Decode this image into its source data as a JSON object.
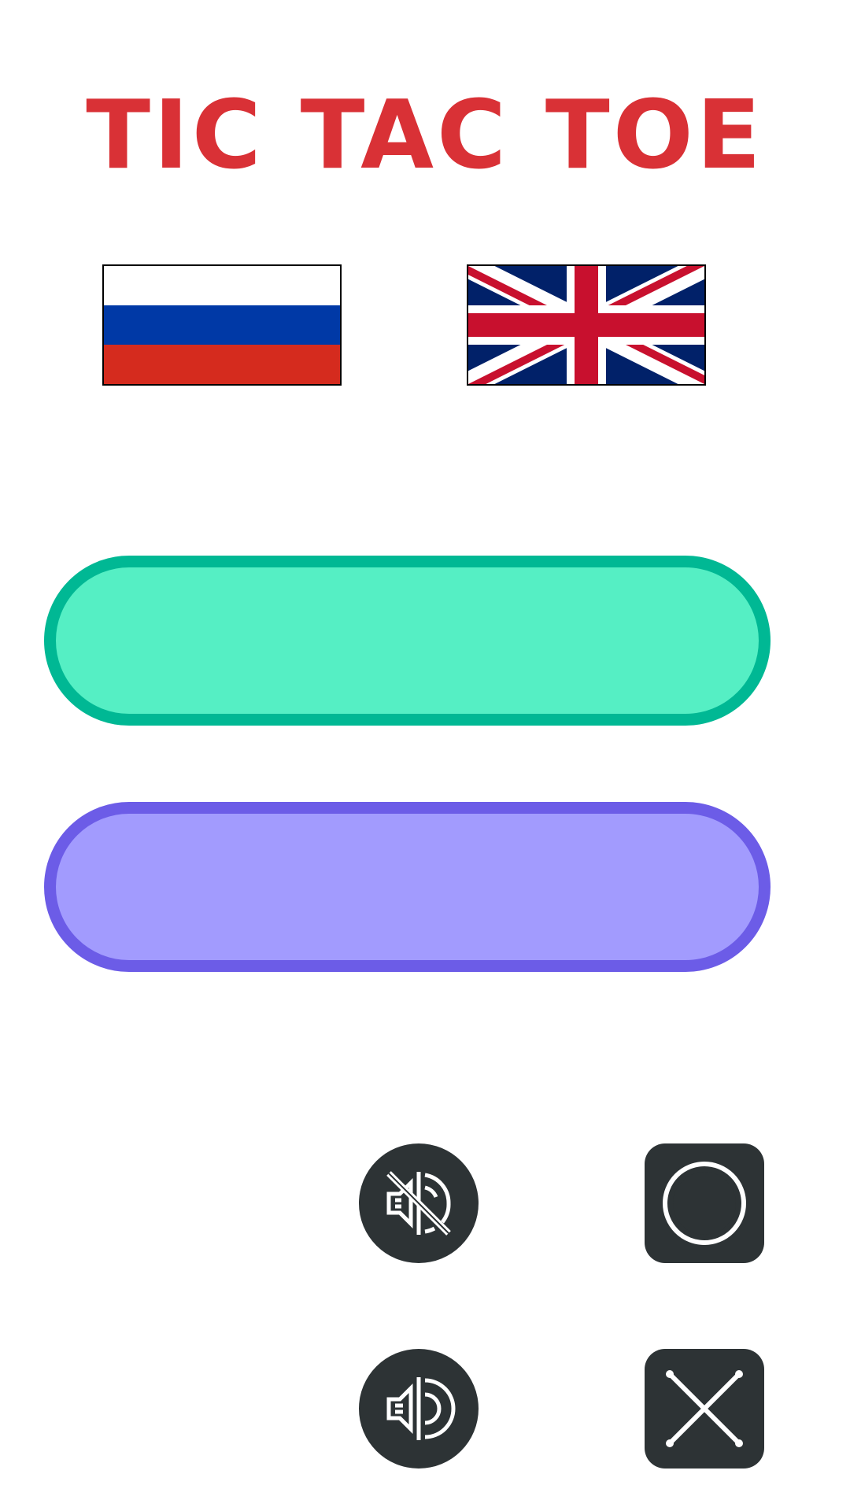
{
  "app": {
    "title": "TIC TAC TOE"
  },
  "colors": {
    "title": "#d93136",
    "dark_button": "#2d3335",
    "green_fill": "#55efc4",
    "green_border": "#00b894",
    "purple_fill": "#a29bfe",
    "purple_border": "#6c5ce7",
    "flag_ru_white": "#ffffff",
    "flag_ru_blue": "#0039a6",
    "flag_ru_red": "#d52b1e",
    "flag_uk_blue": "#012169",
    "flag_uk_red": "#c8102e"
  },
  "language_options": [
    {
      "code": "ru",
      "icon": "russia-flag-icon"
    },
    {
      "code": "en",
      "icon": "uk-flag-icon"
    }
  ],
  "menu_buttons": [
    {
      "label": ""
    },
    {
      "label": ""
    }
  ],
  "icons": {
    "sound_off": "sound-off-icon",
    "sound_on": "sound-on-icon",
    "play_as_o": "o-mark-icon",
    "play_as_x": "x-mark-icon"
  }
}
